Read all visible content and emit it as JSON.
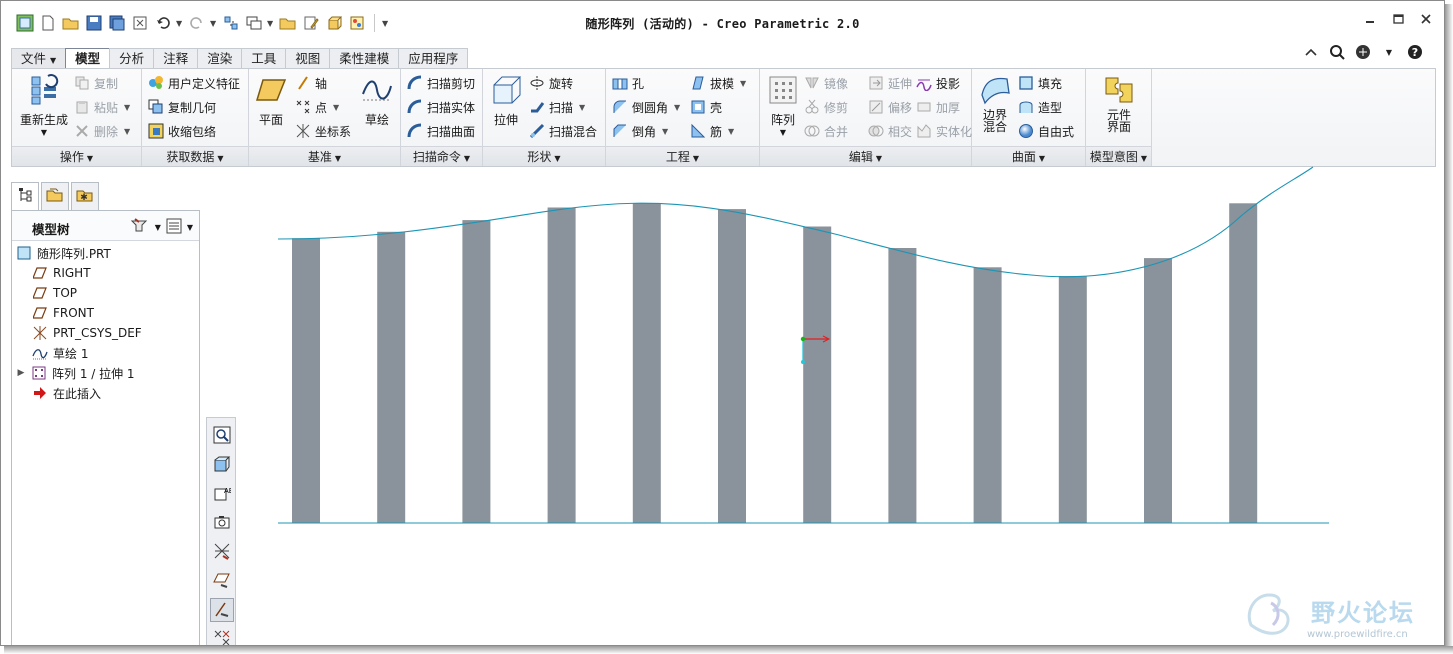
{
  "title": "随形阵列 (活动的) - Creo Parametric 2.0",
  "quick_access": [
    "new-icon",
    "open-icon",
    "save-icon",
    "save-copy-icon",
    "close-window-icon",
    "undo-icon",
    "redo-icon",
    "regenerate-icon",
    "windows-icon",
    "folder-icon",
    "edit-icon",
    "cube-icon",
    "palette-icon",
    "more-icon"
  ],
  "tabs": [
    {
      "label": "文件",
      "active": false,
      "dropdown": true
    },
    {
      "label": "模型",
      "active": true
    },
    {
      "label": "分析",
      "active": false
    },
    {
      "label": "注释",
      "active": false
    },
    {
      "label": "渲染",
      "active": false
    },
    {
      "label": "工具",
      "active": false
    },
    {
      "label": "视图",
      "active": false
    },
    {
      "label": "柔性建模",
      "active": false
    },
    {
      "label": "应用程序",
      "active": false
    }
  ],
  "ribbon": {
    "operations": {
      "label": "操作",
      "regenerate": "重新生成",
      "copy": "复制",
      "paste": "粘贴",
      "delete": "删除"
    },
    "get_data": {
      "label": "获取数据",
      "udf": "用户定义特征",
      "copy_geom": "复制几何",
      "shrinkwrap": "收缩包络"
    },
    "datum": {
      "label": "基准",
      "plane": "平面",
      "axis": "轴",
      "point": "点",
      "csys": "坐标系",
      "sketch": "草绘"
    },
    "sweeps": {
      "label": "扫描命令",
      "sweep_cut": "扫描剪切",
      "sweep_solid": "扫描实体",
      "sweep_surface": "扫描曲面"
    },
    "shapes": {
      "label": "形状",
      "extrude": "拉伸",
      "revolve": "旋转",
      "sweep": "扫描",
      "swept_blend": "扫描混合"
    },
    "engineering": {
      "label": "工程",
      "hole": "孔",
      "round": "倒圆角",
      "chamfer": "倒角",
      "draft": "拔模",
      "shell": "壳",
      "rib": "筋"
    },
    "editing": {
      "label": "编辑",
      "pattern": "阵列",
      "mirror": "镜像",
      "trim": "修剪",
      "merge": "合并",
      "extend": "延伸",
      "offset": "偏移",
      "intersect": "相交",
      "project": "投影",
      "thicken": "加厚",
      "solidify": "实体化"
    },
    "surfaces": {
      "label": "曲面",
      "boundary_blend_1": "边界",
      "boundary_blend_2": "混合",
      "fill": "填充",
      "style": "造型",
      "freestyle": "自由式"
    },
    "model_intent": {
      "label": "模型意图",
      "component_interface_1": "元件",
      "component_interface_2": "界面"
    }
  },
  "model_tree": {
    "title": "模型树",
    "items": [
      {
        "label": "随形阵列.PRT",
        "icon": "part-icon",
        "expandable": false
      },
      {
        "label": "RIGHT",
        "icon": "datum-plane-icon",
        "expandable": false
      },
      {
        "label": "TOP",
        "icon": "datum-plane-icon",
        "expandable": false
      },
      {
        "label": "FRONT",
        "icon": "datum-plane-icon",
        "expandable": false
      },
      {
        "label": "PRT_CSYS_DEF",
        "icon": "csys-icon",
        "expandable": false
      },
      {
        "label": "草绘 1",
        "icon": "sketch-icon",
        "expandable": false
      },
      {
        "label": "阵列 1 / 拉伸 1",
        "icon": "pattern-icon",
        "expandable": true
      },
      {
        "label": "在此插入",
        "icon": "insert-here-icon",
        "expandable": false
      }
    ]
  },
  "view_tools": [
    "refit-icon",
    "display-style-icon",
    "named-views-icon",
    "saved-orientations-icon",
    "datum-display-icon",
    "plane-display-icon",
    "annotation-display-icon",
    "csys-display-icon"
  ],
  "colors": {
    "bar": "#8a929b",
    "curve": "#1b95b5",
    "axis_x": "#e02020",
    "axis_y": "#18b218",
    "axis_z": "#27c7d6"
  },
  "graphics": {
    "pattern_count": 12
  },
  "watermark": {
    "text": "野火论坛",
    "url": "www.proewildfire.cn"
  }
}
